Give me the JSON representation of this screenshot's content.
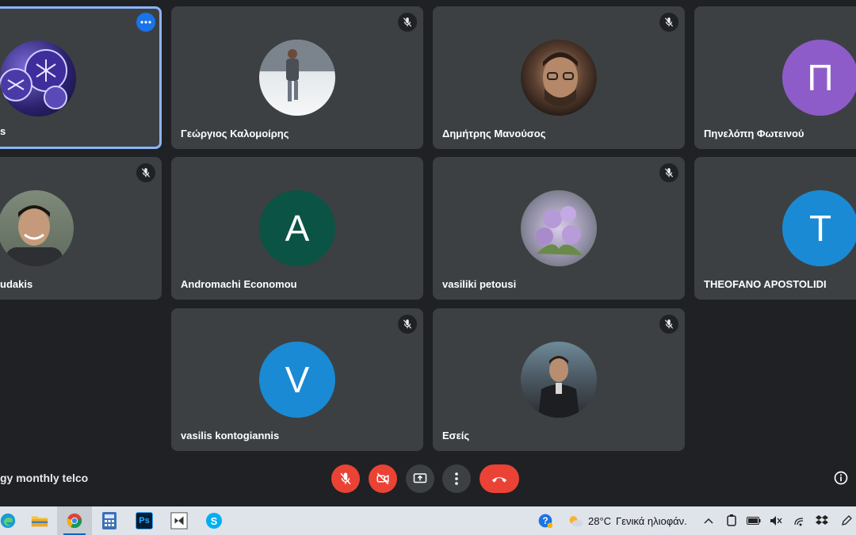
{
  "participants": [
    {
      "name": "s",
      "initial": "",
      "avatar_color": "#4b3a8c",
      "muted": false,
      "active": true
    },
    {
      "name": "Γεώργιος Καλομοίρης",
      "initial": "",
      "avatar_color": "#d9dde2",
      "muted": true,
      "active": false
    },
    {
      "name": "Δημήτρης Μανούσος",
      "initial": "",
      "avatar_color": "#3a2b22",
      "muted": true,
      "active": false
    },
    {
      "name": "Πηνελόπη Φωτεινού",
      "initial": "Π",
      "avatar_color": "#8e5cc9",
      "muted": true,
      "active": false
    },
    {
      "name": "udakis",
      "initial": "",
      "avatar_color": "#6a6f6a",
      "muted": true,
      "active": false
    },
    {
      "name": "Andromachi Economou",
      "initial": "A",
      "avatar_color": "#0b5345",
      "muted": false,
      "active": false
    },
    {
      "name": "vasiliki petousi",
      "initial": "",
      "avatar_color": "#b8a6c9",
      "muted": true,
      "active": false
    },
    {
      "name": "THEOFANO APOSTOLIDI",
      "initial": "T",
      "avatar_color": "#1a8ad4",
      "muted": false,
      "active": false
    },
    {
      "name": "vasilis kontogiannis",
      "initial": "V",
      "avatar_color": "#1a8ad4",
      "muted": true,
      "active": false
    },
    {
      "name": "Εσείς",
      "initial": "",
      "avatar_color": "#5c6670",
      "muted": true,
      "active": false
    }
  ],
  "meeting": {
    "title": "gy monthly telco"
  },
  "controls": {
    "mic": "mic-off-icon",
    "camera": "camera-off-icon",
    "present": "present-screen-icon",
    "more": "more-options-icon",
    "end": "end-call-icon",
    "info": "info-icon"
  },
  "taskbar": {
    "apps": [
      "edge",
      "file-explorer",
      "chrome",
      "calculator",
      "photoshop",
      "visual-studio",
      "skype"
    ],
    "photoshop_label": "Ps",
    "skype_label": "S",
    "weather_temp": "28°C",
    "weather_desc": "Γενικά ηλιοφάν."
  },
  "colors": {
    "background": "#202124",
    "tile": "#3c4043",
    "danger": "#ea4335",
    "accent": "#8ab4f8"
  }
}
